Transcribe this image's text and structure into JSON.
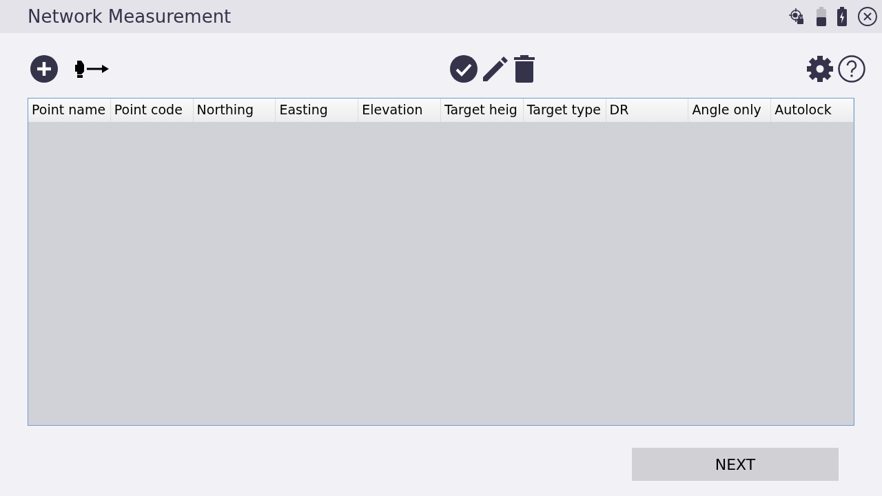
{
  "window": {
    "title": "Network Measurement"
  },
  "table": {
    "columns": [
      "Point name",
      "Point code",
      "Northing",
      "Easting",
      "Elevation",
      "Target heig",
      "Target type",
      "DR",
      "Angle only",
      "Autolock"
    ]
  },
  "buttons": [
    "NEXT"
  ]
}
